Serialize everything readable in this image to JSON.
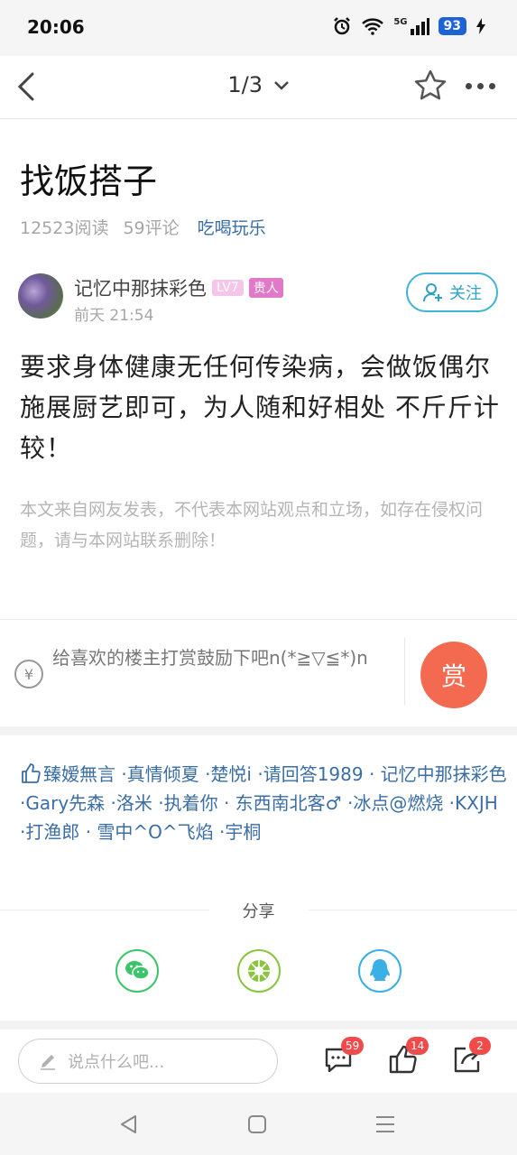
{
  "status_bar": {
    "time": "20:06",
    "network": "5G",
    "battery": "93"
  },
  "header": {
    "pager": "1/3"
  },
  "post": {
    "title": "找饭搭子",
    "reads": "12523阅读",
    "comments": "59评论",
    "category": "吃喝玩乐",
    "author": "记忆中那抹彩色",
    "level": "LV7",
    "rank": "贵人",
    "time": "前天 21:54",
    "follow_label": "关注",
    "body": "要求身体健康无任何传染病，会做饭偶尔施展厨艺即可，为人随和好相处 不斤斤计较！",
    "disclaimer": "本文来自网友发表，不代表本网站观点和立场，如存在侵权问题，请与本网站联系删除！"
  },
  "reward": {
    "text": "给喜欢的楼主打赏鼓励下吧n(*≧▽≦*)n",
    "button": "赏"
  },
  "likers": {
    "text": "臻嫒無言 ·真情倾夏 ·楚悦i ·请回答1989 · 记忆中那抹彩色 ·Gary先森 ·洛米 ·执着你 · 东西南北客♂ ·冰点@燃烧 ·KXJH ·打渔郎 · 雪中^O^飞焰 ·宇桐"
  },
  "share": {
    "label": "分享"
  },
  "bottom_bar": {
    "input_placeholder": "说点什么吧...",
    "comment_count": "59",
    "like_count": "14",
    "share_count": "2"
  },
  "colors": {
    "link": "#3a6ea5",
    "follow": "#2ea3c8",
    "reward": "#f46a50",
    "badge_red": "#f04b4b"
  }
}
